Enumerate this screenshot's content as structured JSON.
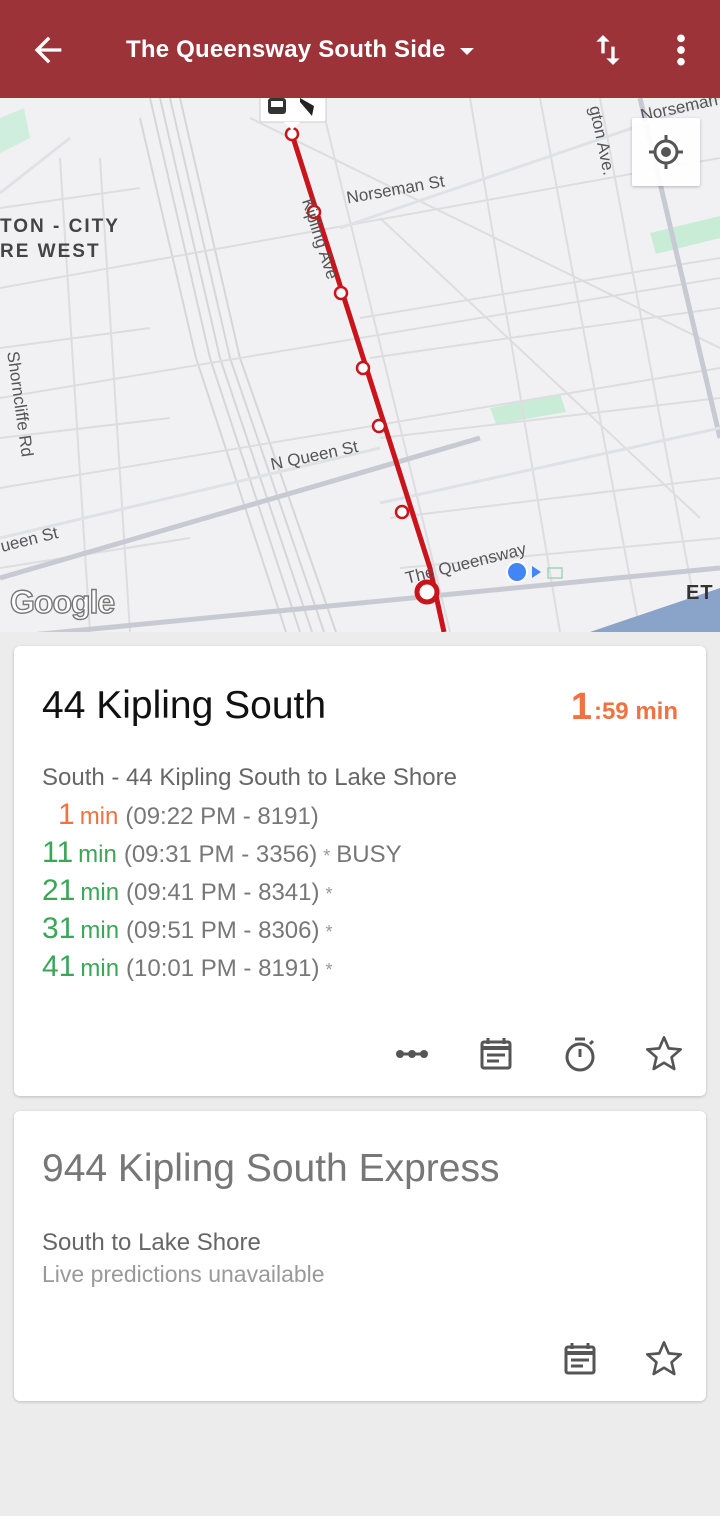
{
  "appbar": {
    "title": "The Queensway South Side",
    "colors": {
      "background": "#9b3338",
      "text": "#ffffff"
    },
    "icons": [
      "back-arrow-icon",
      "dropdown-caret-icon",
      "swap-vert-icon",
      "more-vert-icon"
    ]
  },
  "map": {
    "street_labels": {
      "norseman_top": "Norseman",
      "norseman": "Norseman St",
      "kipling": "Kipling Ave",
      "islington": "gton Ave.",
      "shorncliffe": "Shorncliffe Rd",
      "n_queen": "N Queen St",
      "queen": "ueen St",
      "queensway": "The Queensway"
    },
    "district": {
      "line1": "TON - CITY",
      "line2": "RE WEST"
    },
    "attribution": "Google",
    "corner_label": "ET",
    "colors": {
      "route": "#c9141b",
      "location": "#4285f4"
    }
  },
  "routes": [
    {
      "name": "44 Kipling South",
      "countdown": {
        "minutes": "1",
        "rest": ":59 min"
      },
      "direction": "South - 44 Kipling South to Lake Shore",
      "predictions": [
        {
          "mins": "1",
          "unit": "min",
          "detail": "(09:22 PM - 8191)",
          "flag": "",
          "note": ""
        },
        {
          "mins": "11",
          "unit": "min",
          "detail": "(09:31 PM - 3356)",
          "flag": "*",
          "note": "BUSY"
        },
        {
          "mins": "21",
          "unit": "min",
          "detail": "(09:41 PM - 8341)",
          "flag": "*",
          "note": ""
        },
        {
          "mins": "31",
          "unit": "min",
          "detail": "(09:51 PM - 8306)",
          "flag": "*",
          "note": ""
        },
        {
          "mins": "41",
          "unit": "min",
          "detail": "(10:01 PM - 8191)",
          "flag": "*",
          "note": ""
        }
      ],
      "actions": [
        "more-horiz-icon",
        "schedule-icon",
        "timer-icon",
        "star-outline-icon"
      ],
      "colors": {
        "soon": "#f07240",
        "later": "#3aa757"
      }
    },
    {
      "name": "944 Kipling South Express",
      "direction": "South to Lake Shore",
      "status": "Live predictions unavailable",
      "actions": [
        "schedule-icon",
        "star-outline-icon"
      ]
    }
  ]
}
